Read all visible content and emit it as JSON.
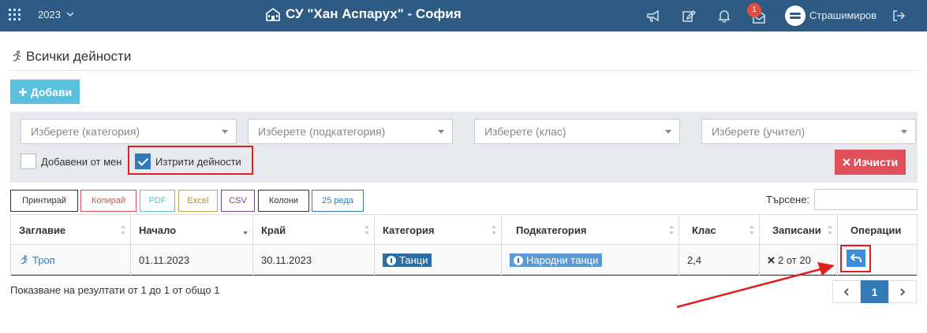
{
  "topbar": {
    "year": "2023",
    "school": "СУ \"Хан Аспарух\" - София",
    "notification_count": "1",
    "username": "Страшимиров",
    "icons": [
      "apps-grid-icon",
      "chevron-down-icon",
      "school-building-icon",
      "megaphone-icon",
      "edit-icon",
      "bell-icon",
      "envelope-icon",
      "avatar",
      "logout-icon"
    ]
  },
  "page": {
    "title": "Всички дейности"
  },
  "actions": {
    "add_label": "Добави",
    "clear_label": "Изчисти"
  },
  "filters": {
    "category_placeholder": "Изберете (категория)",
    "subcategory_placeholder": "Изберете (подкатегория)",
    "class_placeholder": "Изберете (клас)",
    "teacher_placeholder": "Изберете (учител)",
    "added_by_me": {
      "label": "Добавени от мен",
      "checked": false
    },
    "deleted": {
      "label": "Изтрити дейности",
      "checked": true
    }
  },
  "export": {
    "print": "Принтирай",
    "copy": "Копирай",
    "pdf": "PDF",
    "excel": "Excel",
    "csv": "CSV",
    "columns": "Колони",
    "rows": "25 реда"
  },
  "search": {
    "label": "Търсене:",
    "value": ""
  },
  "table": {
    "headers": [
      "Заглавие",
      "Начало",
      "Край",
      "Категория",
      "Подкатегория",
      "Клас",
      "Записани",
      "Операции"
    ],
    "rows": [
      {
        "title": "Троп",
        "start": "01.11.2023",
        "end": "30.11.2023",
        "category": "Танци",
        "subcategory": "Народни танци",
        "class": "2,4",
        "enrolled": "2 от 20"
      }
    ]
  },
  "footer": {
    "info": "Показване на резултати от 1 до 1 от общо 1",
    "current_page": "1"
  },
  "colors": {
    "topbar": "#2e5b84",
    "add": "#5bc0de",
    "clear": "#e05058",
    "primary": "#337ab7",
    "annotation": "#e02020"
  }
}
